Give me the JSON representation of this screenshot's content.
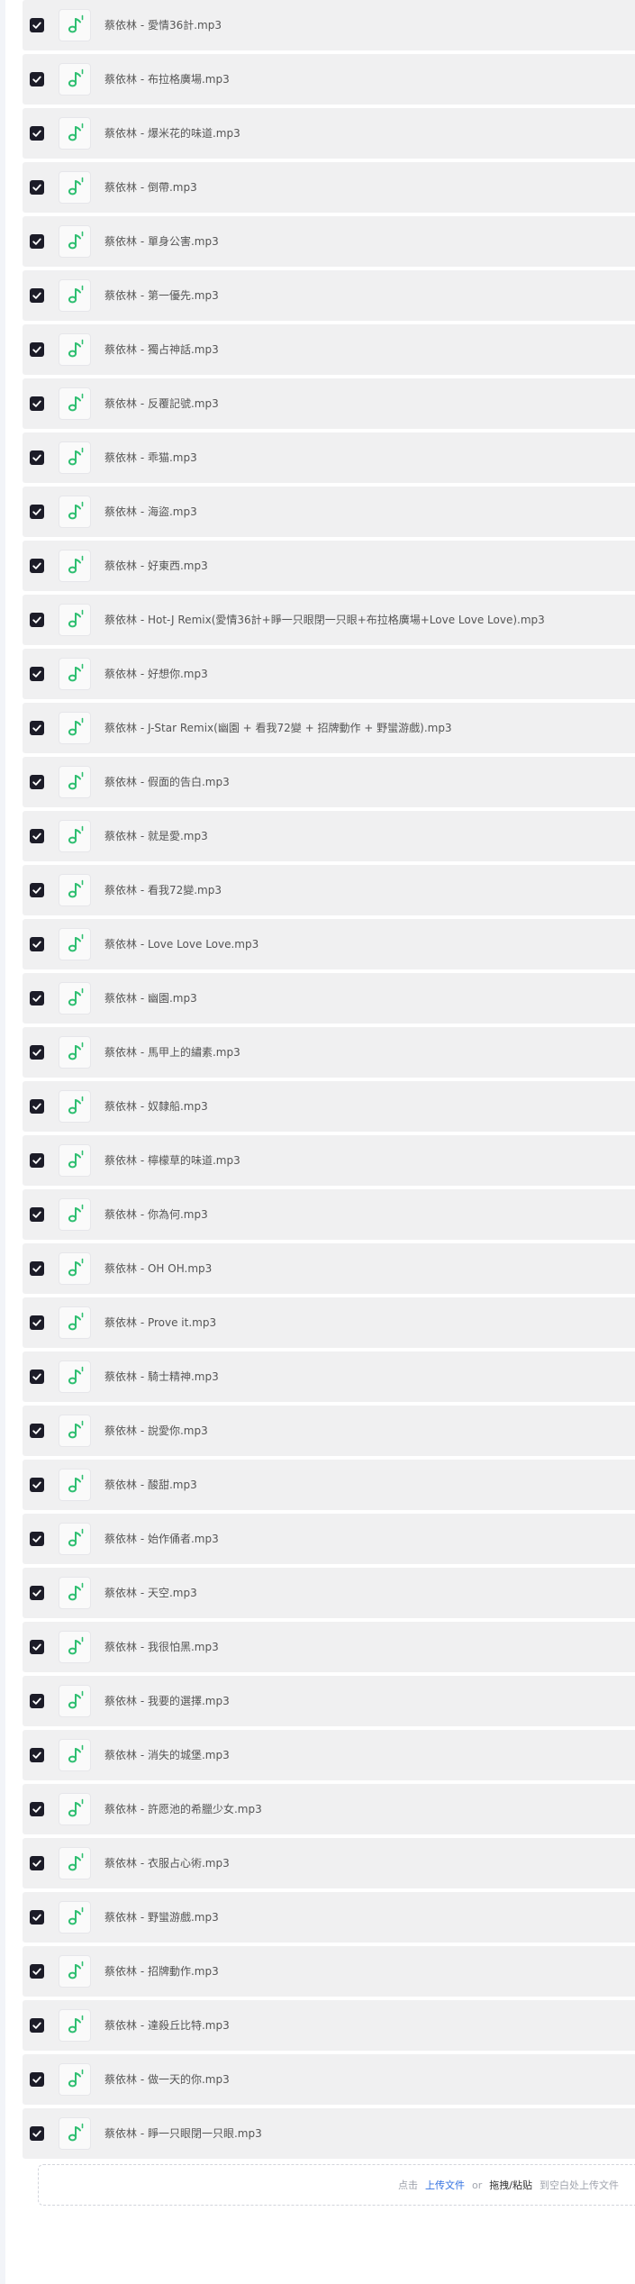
{
  "files": [
    "蔡依林 - 愛情36計.mp3",
    "蔡依林 - 布拉格廣場.mp3",
    "蔡依林 - 爆米花的味道.mp3",
    "蔡依林 - 倒帶.mp3",
    "蔡依林 - 單身公害.mp3",
    "蔡依林 - 第一優先.mp3",
    "蔡依林 - 獨占神話.mp3",
    "蔡依林 - 反覆記號.mp3",
    "蔡依林 - 乖猫.mp3",
    "蔡依林 - 海盜.mp3",
    "蔡依林 - 好東西.mp3",
    "蔡依林 - Hot-J Remix(愛情36計+睜一只眼閉一只眼+布拉格廣場+Love Love Love).mp3",
    "蔡依林 - 好想你.mp3",
    "蔡依林 - J-Star Remix(幽園 + 看我72變 + 招牌動作 + 野蠻游戲).mp3",
    "蔡依林 - 假面的告白.mp3",
    "蔡依林 - 就是愛.mp3",
    "蔡依林 - 看我72變.mp3",
    "蔡依林 - Love Love Love.mp3",
    "蔡依林 - 幽園.mp3",
    "蔡依林 - 馬甲上的繡素.mp3",
    "蔡依林 - 奴隸船.mp3",
    "蔡依林 - 檸檬草的味道.mp3",
    "蔡依林 - 你為何.mp3",
    "蔡依林 - OH OH.mp3",
    "蔡依林 - Prove it.mp3",
    "蔡依林 - 騎士精神.mp3",
    "蔡依林 - 說愛你.mp3",
    "蔡依林 - 酸甜.mp3",
    "蔡依林 - 始作俑者.mp3",
    "蔡依林 - 天空.mp3",
    "蔡依林 - 我很怕黑.mp3",
    "蔡依林 - 我要的選擇.mp3",
    "蔡依林 - 消失的城堡.mp3",
    "蔡依林 - 許愿池的希臘少女.mp3",
    "蔡依林 - 衣服占心術.mp3",
    "蔡依林 - 野蠻游戲.mp3",
    "蔡依林 - 招牌動作.mp3",
    "蔡依林 - 達殺丘比特.mp3",
    "蔡依林 - 做一天的你.mp3",
    "蔡依林 - 睜一只眼閉一只眼.mp3"
  ],
  "file_icon": "music-note-icon",
  "checkbox_state": "checked",
  "upload": {
    "click_text": "点击",
    "upload_link": "上传文件",
    "or_text": "or",
    "drag_link": "拖拽/粘贴",
    "tail_text": "到空白处上传文件"
  },
  "colors": {
    "row_background": "#f0f0f1",
    "checkbox": "#1c1c28",
    "icon_green": "#2fbf71",
    "link_blue": "#3070e0"
  }
}
